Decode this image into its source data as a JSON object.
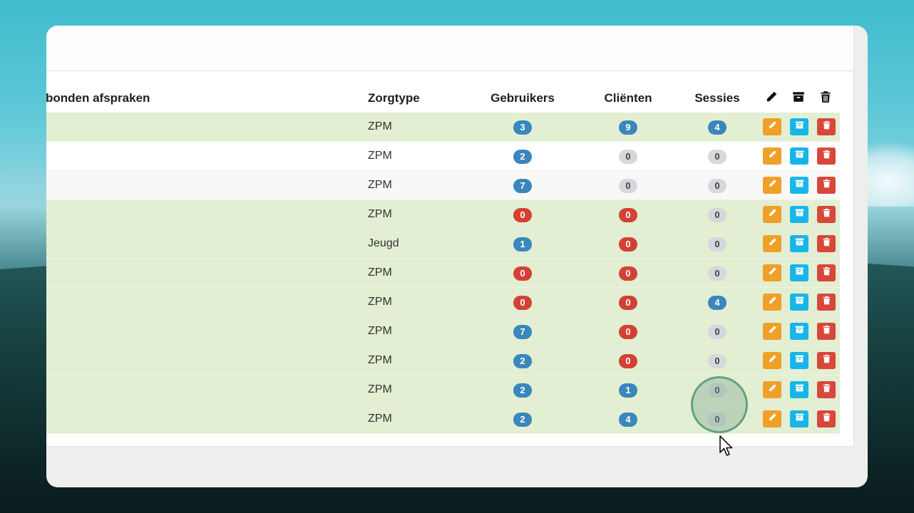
{
  "table": {
    "headers": {
      "afspraken": "bonden afspraken",
      "zorgtype": "Zorgtype",
      "gebruikers": "Gebruikers",
      "clienten": "Cliënten",
      "sessies": "Sessies"
    },
    "header_icons": [
      "pencil-icon",
      "archive-icon",
      "trash-icon"
    ],
    "rows": [
      {
        "zorgtype": "ZPM",
        "gebruikers": "3",
        "gebruikers_color": "blue",
        "clienten": "9",
        "clienten_color": "blue",
        "sessies": "4",
        "sessies_color": "blue",
        "bg": "green"
      },
      {
        "zorgtype": "ZPM",
        "gebruikers": "2",
        "gebruikers_color": "blue",
        "clienten": "0",
        "clienten_color": "grey",
        "sessies": "0",
        "sessies_color": "grey",
        "bg": "white"
      },
      {
        "zorgtype": "ZPM",
        "gebruikers": "7",
        "gebruikers_color": "blue",
        "clienten": "0",
        "clienten_color": "grey",
        "sessies": "0",
        "sessies_color": "grey",
        "bg": "grey"
      },
      {
        "zorgtype": "ZPM",
        "gebruikers": "0",
        "gebruikers_color": "red",
        "clienten": "0",
        "clienten_color": "red",
        "sessies": "0",
        "sessies_color": "grey",
        "bg": "green"
      },
      {
        "zorgtype": "Jeugd",
        "gebruikers": "1",
        "gebruikers_color": "blue",
        "clienten": "0",
        "clienten_color": "red",
        "sessies": "0",
        "sessies_color": "grey",
        "bg": "green"
      },
      {
        "zorgtype": "ZPM",
        "gebruikers": "0",
        "gebruikers_color": "red",
        "clienten": "0",
        "clienten_color": "red",
        "sessies": "0",
        "sessies_color": "grey",
        "bg": "green"
      },
      {
        "zorgtype": "ZPM",
        "gebruikers": "0",
        "gebruikers_color": "red",
        "clienten": "0",
        "clienten_color": "red",
        "sessies": "4",
        "sessies_color": "blue",
        "bg": "green"
      },
      {
        "zorgtype": "ZPM",
        "gebruikers": "7",
        "gebruikers_color": "blue",
        "clienten": "0",
        "clienten_color": "red",
        "sessies": "0",
        "sessies_color": "grey",
        "bg": "green"
      },
      {
        "zorgtype": "ZPM",
        "gebruikers": "2",
        "gebruikers_color": "blue",
        "clienten": "0",
        "clienten_color": "red",
        "sessies": "0",
        "sessies_color": "grey",
        "bg": "green"
      },
      {
        "zorgtype": "ZPM",
        "gebruikers": "2",
        "gebruikers_color": "blue",
        "clienten": "1",
        "clienten_color": "blue",
        "sessies": "0",
        "sessies_color": "grey",
        "bg": "green"
      },
      {
        "zorgtype": "ZPM",
        "gebruikers": "2",
        "gebruikers_color": "blue",
        "clienten": "4",
        "clienten_color": "blue",
        "sessies": "0",
        "sessies_color": "grey",
        "bg": "green"
      }
    ],
    "row_actions": [
      "edit-button",
      "archive-button",
      "delete-button"
    ]
  },
  "colors": {
    "badge_blue": "#3a86bd",
    "badge_red": "#d54035",
    "badge_grey": "#d5d8dc",
    "edit": "#f0a028",
    "archive": "#18b6e8",
    "delete": "#d9473b",
    "row_green": "#e2efd2"
  }
}
